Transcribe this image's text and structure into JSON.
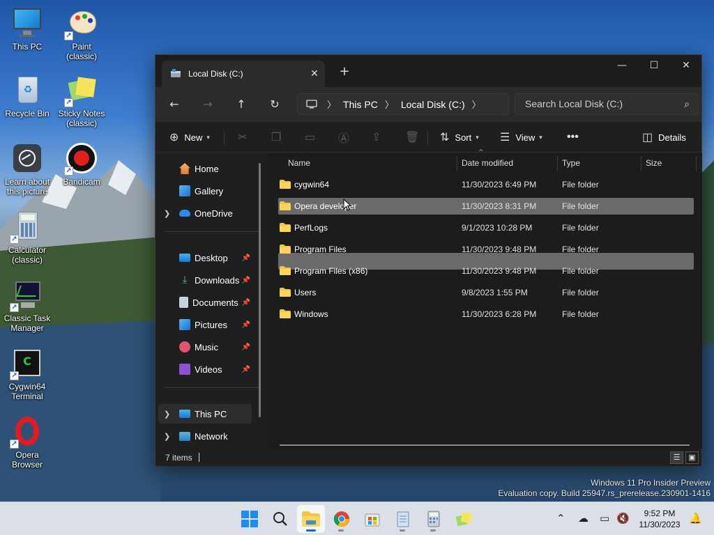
{
  "desktop": {
    "icons": [
      {
        "label": "This PC"
      },
      {
        "label": "Paint (classic)"
      },
      {
        "label": "Recycle Bin"
      },
      {
        "label": "Sticky Notes (classic)"
      },
      {
        "label": "Learn about this picture"
      },
      {
        "label": "Bandicam"
      },
      {
        "label": "Calculator (classic)"
      },
      {
        "label": "Classic Task Manager"
      },
      {
        "label": "Cygwin64 Terminal"
      },
      {
        "label": "Opera Browser"
      }
    ],
    "watermark_line1": "Windows 11 Pro Insider Preview",
    "watermark_line2": "Evaluation copy. Build 25947.rs_prerelease.230901-1416"
  },
  "window": {
    "tab_title": "Local Disk (C:)",
    "breadcrumb": [
      "This PC",
      "Local Disk (C:)"
    ],
    "search_placeholder": "Search Local Disk (C:)",
    "commands": {
      "new": "New",
      "sort": "Sort",
      "view": "View",
      "details": "Details"
    },
    "sidebar": {
      "home": "Home",
      "gallery": "Gallery",
      "onedrive": "OneDrive",
      "desktop": "Desktop",
      "downloads": "Downloads",
      "documents": "Documents",
      "pictures": "Pictures",
      "music": "Music",
      "videos": "Videos",
      "thispc": "This PC",
      "network": "Network"
    },
    "columns": {
      "name": "Name",
      "date": "Date modified",
      "type": "Type",
      "size": "Size"
    },
    "files": [
      {
        "name": "cygwin64",
        "date": "11/30/2023 6:49 PM",
        "type": "File folder"
      },
      {
        "name": "Opera developer",
        "date": "11/30/2023 8:31 PM",
        "type": "File folder"
      },
      {
        "name": "PerfLogs",
        "date": "9/1/2023 10:28 PM",
        "type": "File folder"
      },
      {
        "name": "Program Files",
        "date": "11/30/2023 9:48 PM",
        "type": "File folder"
      },
      {
        "name": "Program Files (x86)",
        "date": "11/30/2023 9:48 PM",
        "type": "File folder"
      },
      {
        "name": "Users",
        "date": "9/8/2023 1:55 PM",
        "type": "File folder"
      },
      {
        "name": "Windows",
        "date": "11/30/2023 6:28 PM",
        "type": "File folder"
      }
    ],
    "status_count": "7 items"
  },
  "taskbar": {
    "time": "9:52 PM",
    "date": "11/30/2023"
  },
  "colors": {
    "folder": "#f4c543",
    "accent": "#1a5fd1",
    "window_bg": "#1f1f1f"
  }
}
